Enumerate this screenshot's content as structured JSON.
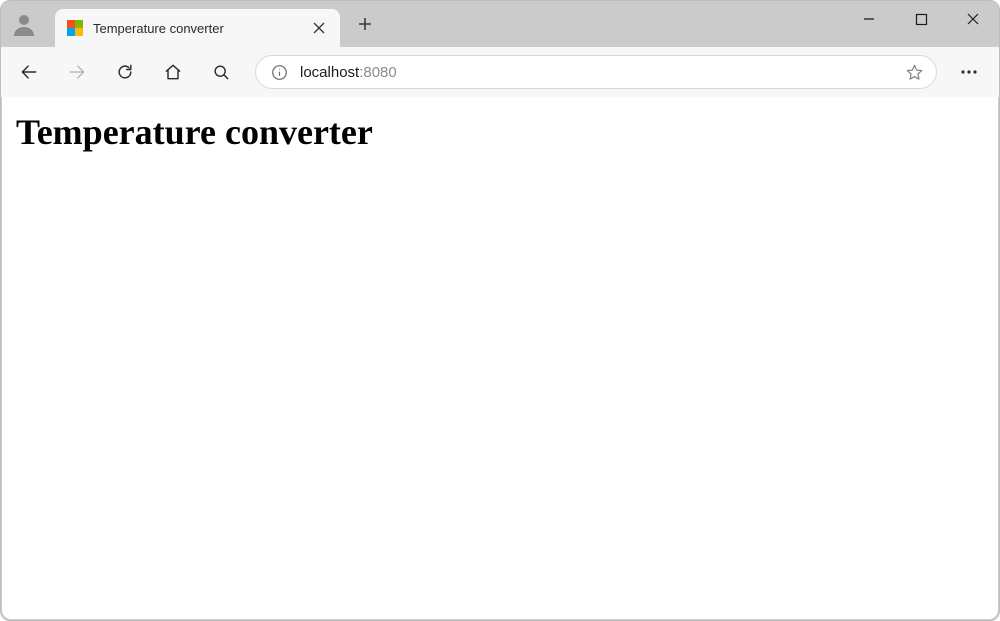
{
  "tab": {
    "title": "Temperature converter"
  },
  "address": {
    "host": "localhost",
    "port": ":8080"
  },
  "page": {
    "heading": "Temperature converter"
  }
}
